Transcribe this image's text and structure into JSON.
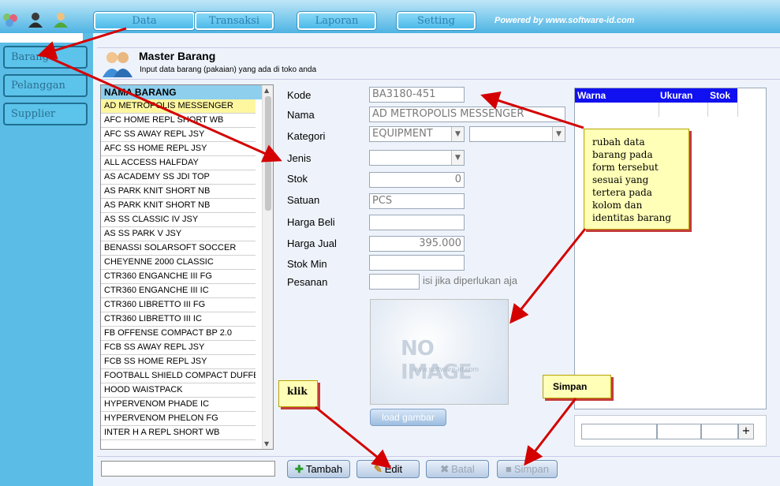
{
  "topbar": {
    "icons": [
      "people-group-icon",
      "dark-user-icon",
      "green-user-icon"
    ],
    "menu": [
      "Data",
      "Transaksi",
      "Laporan",
      "Setting"
    ],
    "powered_by": "Powered by www.software-id.com"
  },
  "sidebar": {
    "items": [
      {
        "label": "Barang"
      },
      {
        "label": "Pelanggan"
      },
      {
        "label": "Supplier"
      }
    ]
  },
  "header": {
    "icon": "users-icon",
    "title": "Master Barang",
    "subtitle": "Input data barang (pakaian) yang ada di toko anda"
  },
  "item_list": {
    "header": "NAMA BARANG",
    "rows": [
      "AD METROPOLIS MESSENGER",
      "AFC HOME  REPL SHORT WB",
      "AFC SS AWAY REPL JSY",
      "AFC SS HOME REPL JSY",
      "ALL ACCESS HALFDAY",
      "AS ACADEMY SS JDI TOP",
      "AS PARK KNIT SHORT NB",
      "AS PARK KNIT SHORT NB",
      "AS SS CLASSIC IV JSY",
      "AS SS PARK V JSY",
      "BENASSI SOLARSOFT SOCCER",
      "CHEYENNE 2000 CLASSIC",
      "CTR360 ENGANCHE III FG",
      "CTR360 ENGANCHE III IC",
      "CTR360 LIBRETTO III FG",
      "CTR360 LIBRETTO III IC",
      "FB OFFENSE COMPACT BP 2.0",
      "FCB SS AWAY REPL JSY",
      "FCB SS HOME REPL JSY",
      "FOOTBALL SHIELD COMPACT DUFFE",
      "HOOD WAISTPACK",
      "HYPERVENOM PHADE IC",
      "HYPERVENOM PHELON FG",
      "INTER H A REPL SHORT WB"
    ],
    "selected_index": 0
  },
  "form": {
    "kode": {
      "label": "Kode",
      "value": "BA3180-451"
    },
    "nama": {
      "label": "Nama",
      "value": "AD METROPOLIS MESSENGER"
    },
    "kategori": {
      "label": "Kategori",
      "value": "EQUIPMENT",
      "value2": ""
    },
    "jenis": {
      "label": "Jenis",
      "value": ""
    },
    "stok": {
      "label": "Stok",
      "value": "0"
    },
    "satuan": {
      "label": "Satuan",
      "value": "PCS"
    },
    "harga_beli": {
      "label": "Harga Beli",
      "value": ""
    },
    "harga_jual": {
      "label": "Harga Jual",
      "value": "395.000"
    },
    "stok_min": {
      "label": "Stok Min",
      "value": ""
    },
    "pesanan": {
      "label": "Pesanan",
      "value": "",
      "hint": "isi jika diperlukan aja"
    }
  },
  "image_box": {
    "text": "NO IMAGE",
    "url_text": "www.software-id.com",
    "load_label": "load gambar"
  },
  "variant_grid": {
    "columns": [
      "Warna",
      "Ukuran",
      "Stok"
    ],
    "plus_label": "+"
  },
  "actions": {
    "tambah": "Tambah",
    "edit": "Edit",
    "batal": "Batal",
    "simpan": "Simpan"
  },
  "annotations": {
    "main_note": [
      "rubah data",
      "barang pada",
      "form tersebut",
      "sesuai yang",
      "tertera pada",
      "kolom dan",
      "identitas barang"
    ],
    "klik": "klik",
    "simpan": "Simpan"
  },
  "colors": {
    "topbar": "#4fb3e3",
    "sidebar": "#5bbde6",
    "list_header": "#8ecfee",
    "grid_header": "#1010f0",
    "selected_row": "#fff7a0",
    "note_bg": "#ffffb8",
    "arrow": "#d40000"
  }
}
